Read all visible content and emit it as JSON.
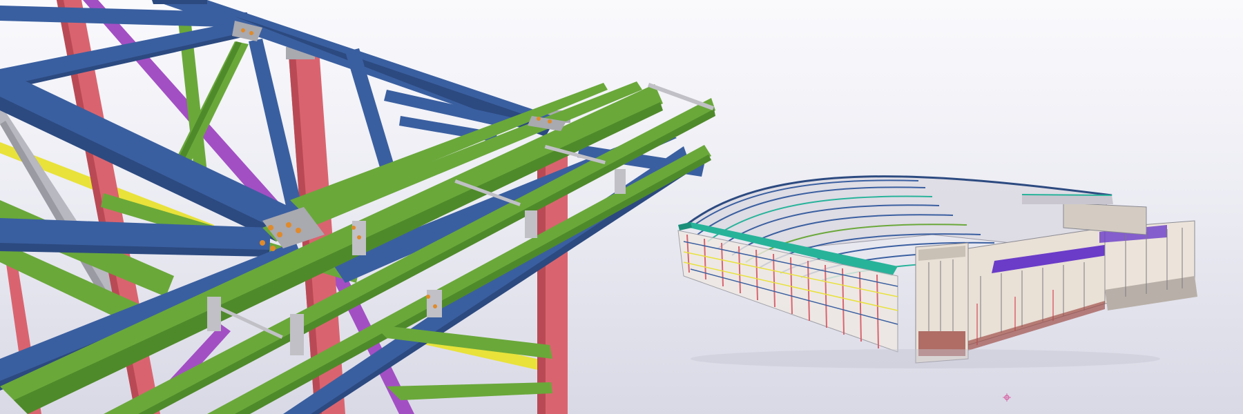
{
  "viewport": {
    "background_top": "#fafafd",
    "background_bottom": "#d9d9e6"
  },
  "colors": {
    "beam_blue": "#3a5fa0",
    "beam_blue_dark": "#2c4a80",
    "beam_green": "#6aa83a",
    "beam_green_dark": "#4f8a2a",
    "column_red": "#d9646f",
    "column_red_dark": "#b94a55",
    "brace_purple": "#a34fc4",
    "brace_yellow": "#e8e23a",
    "brace_grey": "#b8b8c0",
    "connection_grey": "#a9a9b0",
    "roof_teal": "#27b39a",
    "facade_beige": "#e9e0d6",
    "facade_purple": "#6a3cc8"
  },
  "models": [
    {
      "name": "steel-connection-detail-model"
    },
    {
      "name": "stadium-building-overview-model"
    }
  ]
}
